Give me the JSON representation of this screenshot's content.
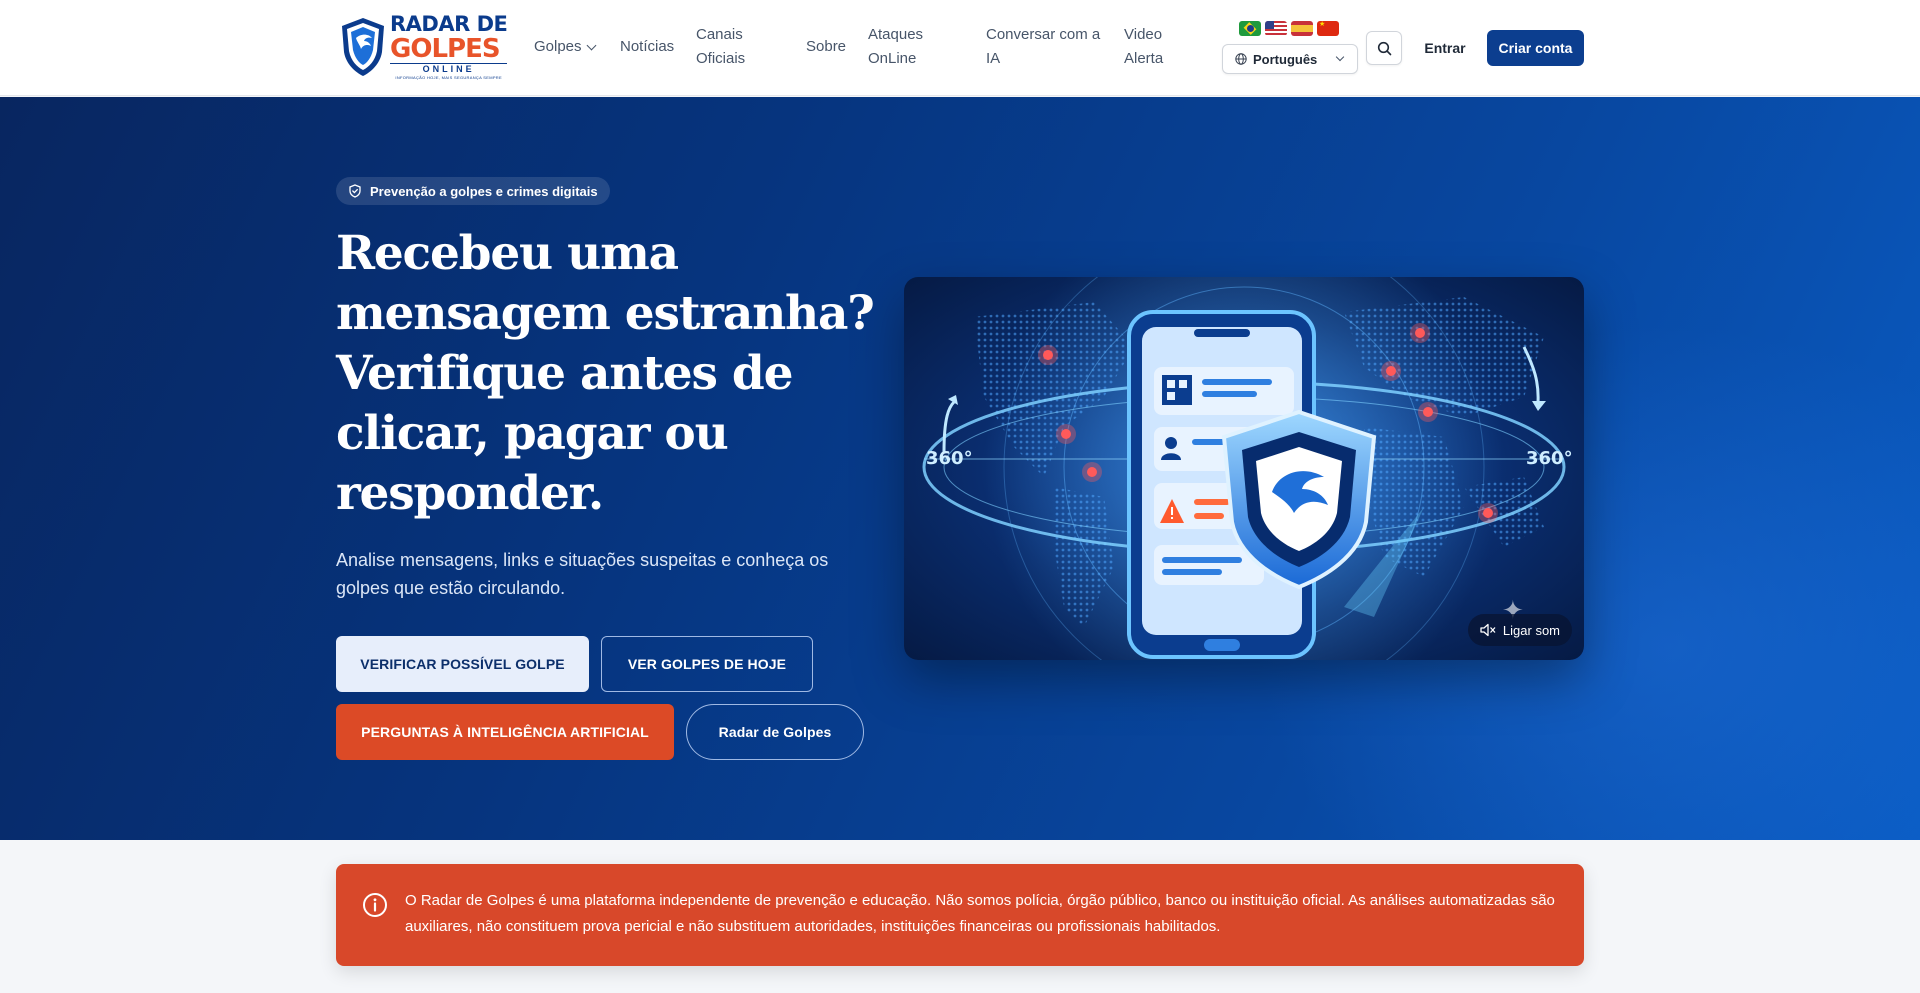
{
  "header": {
    "logo": {
      "line1": "RADAR DE",
      "line2": "GOLPES",
      "line3": "ONLINE",
      "tagline": "INFORMAÇÃO HOJE, MAIS SEGURANÇA SEMPRE"
    },
    "nav": {
      "golpes": "Golpes",
      "noticias": "Notícias",
      "canais": "Canais Oficiais",
      "sobre": "Sobre",
      "ataques": "Ataques OnLine",
      "ia": "Conversar com a IA",
      "video": "Video Alerta"
    },
    "flags": [
      "Brasil",
      "United States",
      "España",
      "中国"
    ],
    "language": "Português",
    "entrar": "Entrar",
    "criar_conta": "Criar conta"
  },
  "hero": {
    "badge": "Prevenção a golpes e crimes digitais",
    "title": "Recebeu uma mensagem estranha? Verifique antes de clicar, pagar ou responder.",
    "subtitle": "Analise mensagens, links e situações suspeitas e conheça os golpes que estão circulando.",
    "buttons": {
      "verificar": "VERIFICAR POSSÍVEL GOLPE",
      "hoje": "VER GOLPES DE HOJE",
      "ia": "PERGUNTAS À INTELIGÊNCIA ARTIFICIAL",
      "radar": "Radar de Golpes"
    },
    "media": {
      "sound_label": "Ligar som",
      "degree_left": "360°",
      "degree_right": "360°"
    }
  },
  "notice": {
    "text": "O Radar de Golpes é uma plataforma independente de prevenção e educação. Não somos polícia, órgão público, banco ou instituição oficial. As análises automatizadas são auxiliares, não constituem prova pericial e não substituem autoridades, instituições financeiras ou profissionais habilitados."
  },
  "colors": {
    "primary": "#0c3e8f",
    "accent": "#dc4a26",
    "hero_bg": "#06347e",
    "notice_bg": "#d8482a"
  }
}
